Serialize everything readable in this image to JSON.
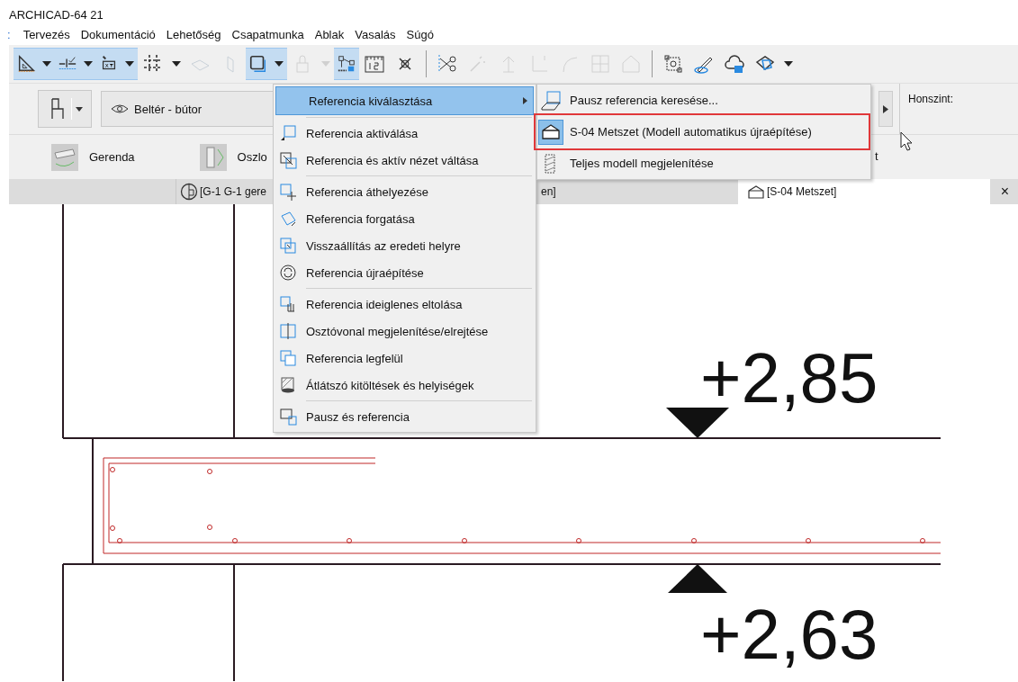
{
  "window": {
    "title": "ARCHICAD-64 21"
  },
  "menu_bar": {
    "overflow": ":",
    "items": [
      "Tervezés",
      "Dokumentáció",
      "Lehetőség",
      "Csapatmunka",
      "Ablak",
      "Vasalás",
      "Súgó"
    ]
  },
  "toolbar": [
    {
      "kind": "tool",
      "selected": true,
      "disabled": false
    },
    {
      "kind": "drop",
      "selected": true,
      "disabled": false
    },
    {
      "kind": "tool",
      "selected": true,
      "disabled": false
    },
    {
      "kind": "drop",
      "selected": true,
      "disabled": false
    },
    {
      "kind": "tool",
      "selected": true,
      "disabled": false
    },
    {
      "kind": "drop",
      "selected": true,
      "disabled": false
    },
    {
      "kind": "tool",
      "selected": false,
      "disabled": false
    },
    {
      "kind": "drop",
      "selected": false,
      "disabled": false
    },
    {
      "kind": "tool",
      "selected": false,
      "disabled": true
    },
    {
      "kind": "tool",
      "selected": false,
      "disabled": true
    },
    {
      "kind": "tool",
      "selected": true,
      "disabled": false
    },
    {
      "kind": "drop",
      "selected": true,
      "disabled": false
    },
    {
      "kind": "tool",
      "selected": false,
      "disabled": true
    },
    {
      "kind": "drop",
      "selected": false,
      "disabled": true
    },
    {
      "kind": "tool",
      "selected": true,
      "disabled": false
    },
    {
      "kind": "tool",
      "selected": false,
      "disabled": false
    },
    {
      "kind": "tool",
      "selected": false,
      "disabled": false
    },
    {
      "kind": "sep"
    },
    {
      "kind": "tool",
      "selected": false,
      "disabled": false
    },
    {
      "kind": "tool",
      "selected": false,
      "disabled": true
    },
    {
      "kind": "tool",
      "selected": false,
      "disabled": true
    },
    {
      "kind": "tool",
      "selected": false,
      "disabled": true
    },
    {
      "kind": "tool",
      "selected": false,
      "disabled": true
    },
    {
      "kind": "tool",
      "selected": false,
      "disabled": true
    },
    {
      "kind": "tool",
      "selected": false,
      "disabled": true
    },
    {
      "kind": "sep"
    },
    {
      "kind": "tool",
      "selected": false,
      "disabled": false
    },
    {
      "kind": "tool",
      "selected": false,
      "disabled": false
    },
    {
      "kind": "tool",
      "selected": false,
      "disabled": false
    },
    {
      "kind": "tool",
      "selected": false,
      "disabled": false
    },
    {
      "kind": "drop",
      "selected": false,
      "disabled": false
    }
  ],
  "info_box": {
    "view_dropdown": "Beltér - bútor",
    "tools": [
      {
        "label": "Gerenda"
      },
      {
        "label": "Oszlo"
      }
    ],
    "fragment": "t",
    "story_label": "Honszint:"
  },
  "tabs": [
    {
      "label_start": "[G-1 G-1 gere",
      "label_end": "en]",
      "selected": false
    },
    {
      "label": "[S-04 Metszet]",
      "selected": true
    }
  ],
  "tab_close": "×",
  "context_menu": [
    {
      "kind": "item",
      "label": "Referencia kiválasztása",
      "submenu": true,
      "selected": true
    },
    {
      "kind": "separator"
    },
    {
      "kind": "item",
      "label": "Referencia aktiválása",
      "submenu": false,
      "selected": false
    },
    {
      "kind": "item",
      "label": "Referencia és aktív nézet váltása",
      "submenu": false,
      "selected": false
    },
    {
      "kind": "separator"
    },
    {
      "kind": "item",
      "label": "Referencia áthelyezése",
      "submenu": false,
      "selected": false
    },
    {
      "kind": "item",
      "label": "Referencia forgatása",
      "submenu": false,
      "selected": false
    },
    {
      "kind": "item",
      "label": "Visszaállítás az eredeti helyre",
      "submenu": false,
      "selected": false
    },
    {
      "kind": "item",
      "label": "Referencia újraépítése",
      "submenu": false,
      "selected": false
    },
    {
      "kind": "separator"
    },
    {
      "kind": "item",
      "label": "Referencia ideiglenes eltolása",
      "submenu": false,
      "selected": false
    },
    {
      "kind": "item",
      "label": "Osztóvonal megjelenítése/elrejtése",
      "submenu": false,
      "selected": false
    },
    {
      "kind": "item",
      "label": "Referencia legfelül",
      "submenu": false,
      "selected": false
    },
    {
      "kind": "item",
      "label": "Átlátszó kitöltések és helyiségek",
      "submenu": false,
      "selected": false
    },
    {
      "kind": "separator"
    },
    {
      "kind": "item",
      "label": "Pausz és referencia",
      "submenu": false,
      "selected": false
    }
  ],
  "submenu": [
    {
      "label": "Pausz referencia keresése...",
      "selected": false,
      "callout": false
    },
    {
      "label": "S-04 Metszet (Modell automatikus újraépítése)",
      "selected": true,
      "callout": true
    },
    {
      "label": "Teljes modell megjelenítése",
      "selected": false,
      "callout": false
    }
  ],
  "canvas": {
    "levels": [
      {
        "label": "+2,85",
        "pointing_down": true
      },
      {
        "label": "+2,63",
        "pointing_down": false
      }
    ]
  }
}
